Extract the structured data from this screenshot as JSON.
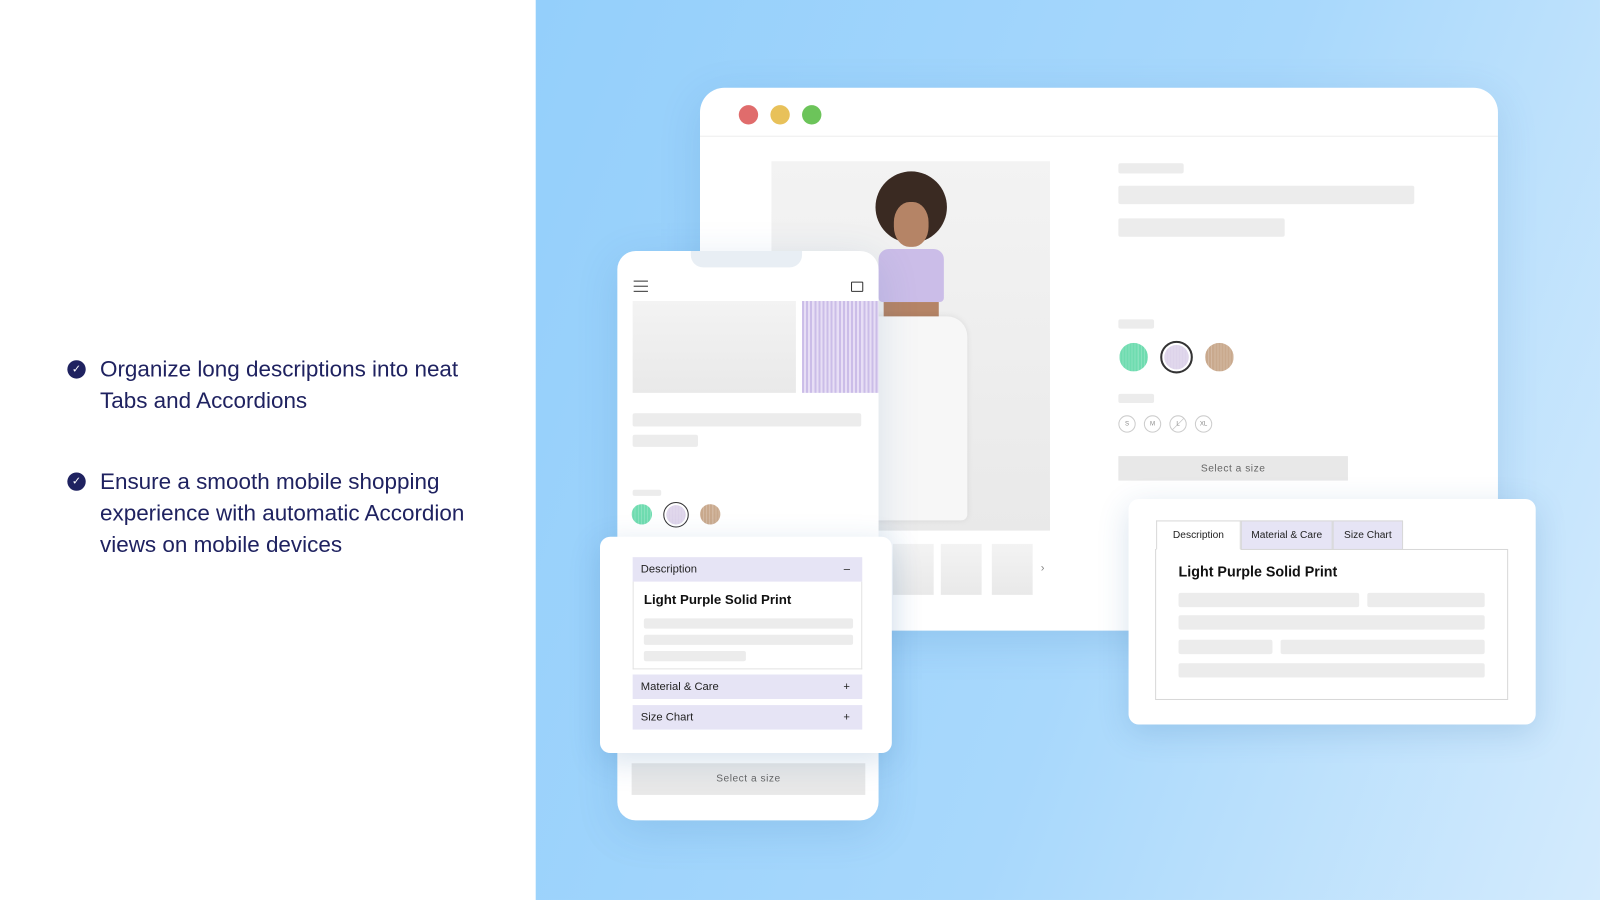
{
  "features": [
    {
      "icon": "check-circle-icon",
      "text": "Organize long descriptions into neat Tabs and Accordions"
    },
    {
      "icon": "check-circle-icon",
      "text": "Ensure a smooth mobile shopping experience with automatic Accordion views on mobile devices"
    }
  ],
  "colors": {
    "brand": "#1f2260",
    "accordion_header": "#e6e4f5",
    "background": "#a8d8fc"
  },
  "desktop": {
    "traffic_lights": [
      "#e06c6c",
      "#e8c15a",
      "#6cc45a"
    ],
    "swatches": [
      {
        "color": "#6fdcb0"
      },
      {
        "color": "#ddd3ea",
        "selected": true
      },
      {
        "color": "#c9a98d"
      }
    ],
    "sizes": [
      "S",
      "M",
      "L",
      "XL"
    ],
    "unavailable_size": "L",
    "select_button": "Select a size",
    "next_arrow": "›"
  },
  "tabs_widget": {
    "tabs": [
      "Description",
      "Material & Care",
      "Size Chart"
    ],
    "active_tab": "Description",
    "content_title": "Light Purple Solid Print"
  },
  "mobile": {
    "swatches": [
      {
        "color": "#6fdcb0"
      },
      {
        "color": "#ddd3ea",
        "selected": true
      },
      {
        "color": "#c9a98d"
      }
    ],
    "accordion": [
      {
        "label": "Description",
        "toggle": "–",
        "expanded": true,
        "content_title": "Light Purple Solid Print"
      },
      {
        "label": "Material & Care",
        "toggle": "+",
        "expanded": false
      },
      {
        "label": "Size Chart",
        "toggle": "+",
        "expanded": false
      }
    ],
    "select_button": "Select a size"
  }
}
